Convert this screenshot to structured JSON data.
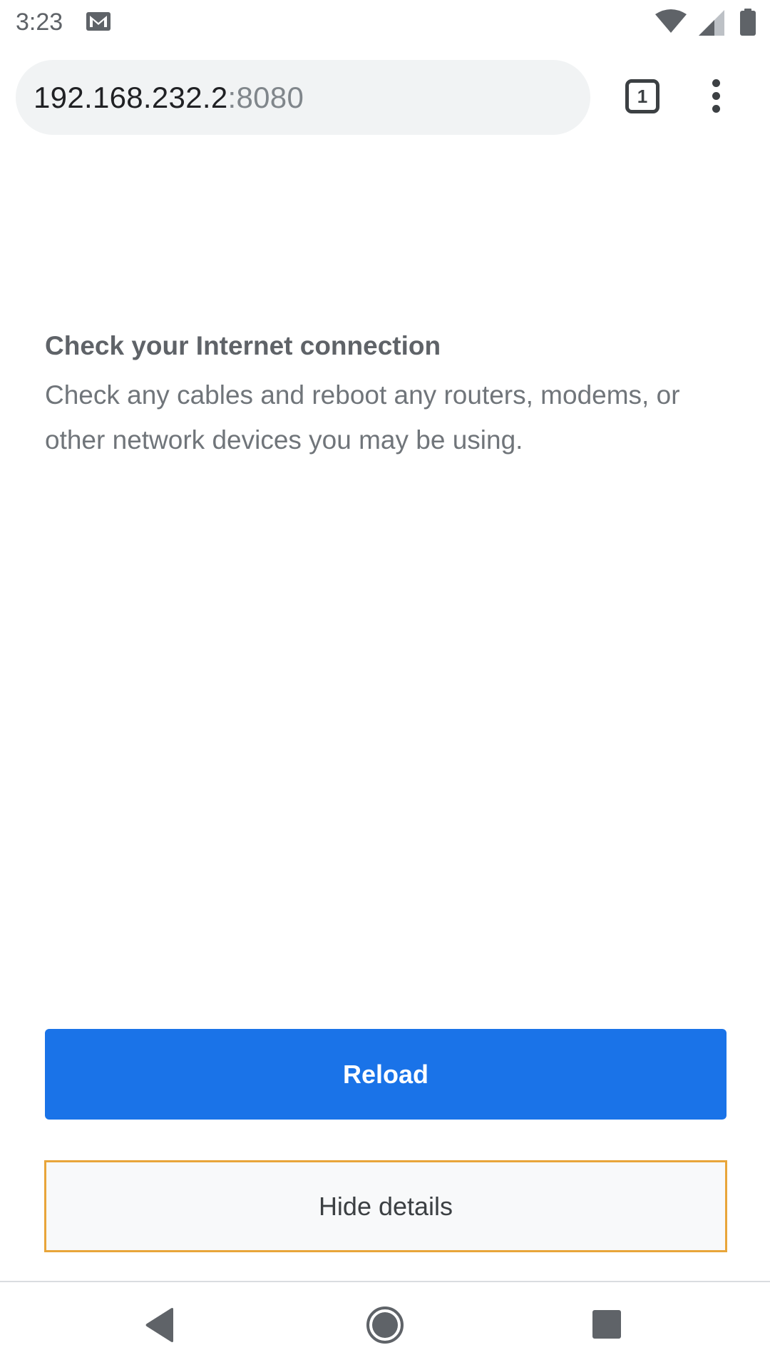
{
  "status_bar": {
    "time": "3:23",
    "icons": [
      "gmail-icon",
      "wifi-icon",
      "cellular-signal-icon",
      "battery-icon"
    ]
  },
  "browser": {
    "url_host": "192.168.232.2",
    "url_port": ":8080",
    "tab_count": "1",
    "menu_icon": "more-vert-icon"
  },
  "error": {
    "heading": "Check your Internet connection",
    "body": "Check any cables and reboot any routers, modems, or other network devices you may be using."
  },
  "buttons": {
    "reload_label": "Reload",
    "details_label": "Hide details"
  },
  "navigation": {
    "icons": [
      "back-icon",
      "home-icon",
      "recents-icon"
    ]
  },
  "colors": {
    "primary_button": "#1a73e8",
    "focus_outline": "#e8a53a",
    "omnibox_bg": "#f1f3f4",
    "secondary_text": "#70757a"
  }
}
